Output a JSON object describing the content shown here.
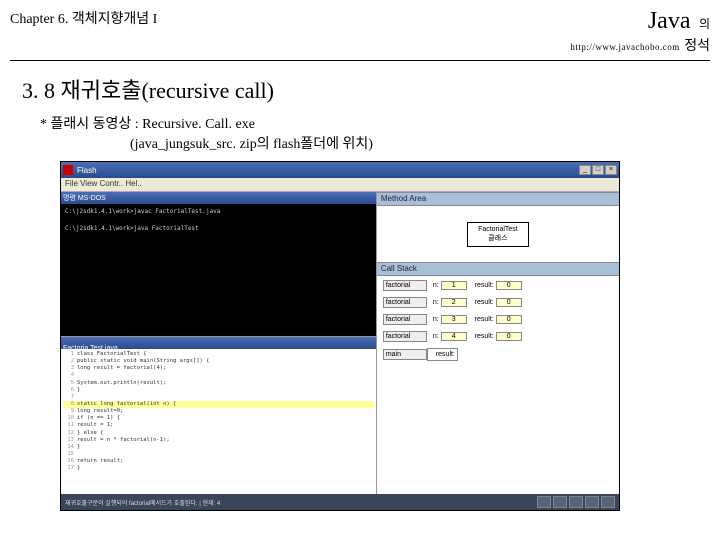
{
  "header": {
    "chapter": "Chapter 6. 객체지향개념 I",
    "java": "Java",
    "eui": "의",
    "jeongseok": "정석",
    "url": "http://www.javachobo.com"
  },
  "section": {
    "title": "3. 8 재귀호출(recursive call)",
    "note": "* 플래시 동영상 : Recursive. Call. exe",
    "sub": "(java_jungsuk_src. zip의 flash폴더에 위치)"
  },
  "app": {
    "title": "Flash",
    "menu": "File  View  Contr..  Hel..",
    "console_title": "명령 MS-DOS",
    "console": "C:\\j2sdk1.4.1\\work>javac FactorialTest.java\n\nC:\\j2sdk1.4.1\\work>java FactorialTest",
    "editor_title": "Factoria Test.java",
    "code": [
      {
        "n": "1",
        "t": "class FactorialTest {"
      },
      {
        "n": "2",
        "t": "  public static void main(String args[]) {"
      },
      {
        "n": "3",
        "t": "    long result = factorial(4);"
      },
      {
        "n": "4",
        "t": ""
      },
      {
        "n": "5",
        "t": "    System.out.println(result);"
      },
      {
        "n": "6",
        "t": "  }"
      },
      {
        "n": "7",
        "t": ""
      },
      {
        "n": "8",
        "t": "  static long factorial(int n) {",
        "hl": true
      },
      {
        "n": "9",
        "t": "    long result=0;"
      },
      {
        "n": "10",
        "t": "    if (n == 1) {"
      },
      {
        "n": "11",
        "t": "      result = 1;"
      },
      {
        "n": "12",
        "t": "    } else {"
      },
      {
        "n": "13",
        "t": "      result = n * factorial(n-1);"
      },
      {
        "n": "14",
        "t": "    }"
      },
      {
        "n": "15",
        "t": ""
      },
      {
        "n": "16",
        "t": "    return result;"
      },
      {
        "n": "17",
        "t": "  }"
      }
    ],
    "panels": {
      "method_area": "Method Area",
      "ma_box1": "FactorialTest",
      "ma_box2": "클래스",
      "call_stack": "Call Stack",
      "frames": [
        {
          "name": "factorial",
          "n": "1",
          "r": "0"
        },
        {
          "name": "factorial",
          "n": "2",
          "r": "0"
        },
        {
          "name": "factorial",
          "n": "3",
          "r": "0"
        },
        {
          "name": "factorial",
          "n": "4",
          "r": "0"
        }
      ],
      "var_n": "n:",
      "var_r": "result:",
      "main": "main",
      "main_var": "result:"
    },
    "bottom": "재귀호출구문이 실행되어 factorial메서드가 호출된다.  |  현재: 4"
  }
}
